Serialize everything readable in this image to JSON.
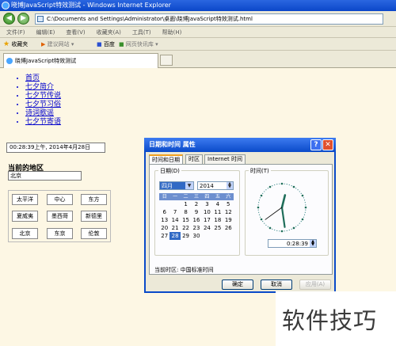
{
  "window": {
    "title": "晓博JavaScript特效测试 - Windows Internet Explorer",
    "address": "C:\\Documents and Settings\\Administrator\\桌面\\晓博JavaScript特效测试.html"
  },
  "menubar": [
    "文件(F)",
    "编辑(E)",
    "查看(V)",
    "收藏夹(A)",
    "工具(T)",
    "帮助(H)"
  ],
  "favbar": {
    "favorites": "收藏夹",
    "suggested": "建议网站 ▾",
    "baidu": "百度",
    "webslice": "网页快讯库 ▾"
  },
  "tab": {
    "title": "晓博JavaScript特效测试"
  },
  "page": {
    "nav_items": [
      "首页",
      "七夕简介",
      "七夕节传说",
      "七夕节习俗",
      "诗词歌谣",
      "七夕节寄语"
    ],
    "clock_text": "00:28:39上午, 2014年4月28日",
    "region_heading": "当前的地区",
    "region_value": "北京",
    "cities": [
      "太平洋",
      "中心",
      "东方",
      "夏威夷",
      "墨西哥",
      "新德里",
      "北京",
      "东京",
      "伦敦"
    ]
  },
  "dialog": {
    "title": "日期和时间 属性",
    "tabs": [
      "时间和日期",
      "时区",
      "Internet 时间"
    ],
    "date_group": "日期(D)",
    "time_group": "时间(T)",
    "month": "四月",
    "year": "2014",
    "weekdays": [
      "日",
      "一",
      "二",
      "三",
      "四",
      "五",
      "六"
    ],
    "days": [
      "",
      "",
      "1",
      "2",
      "3",
      "4",
      "5",
      "6",
      "7",
      "8",
      "9",
      "10",
      "11",
      "12",
      "13",
      "14",
      "15",
      "16",
      "17",
      "18",
      "19",
      "20",
      "21",
      "22",
      "23",
      "24",
      "25",
      "26",
      "27",
      "28",
      "29",
      "30"
    ],
    "selected_day": "28",
    "time_value": "0:28:39",
    "timezone": "当前时区: 中国标准时间",
    "ok": "确定",
    "cancel": "取消",
    "apply": "应用(A)"
  },
  "watermark": "软件技巧",
  "colors": {
    "title_blue": "#0a4ac9",
    "page_bg": "#fdf7e4",
    "selection": "#316ac5",
    "clock_hand": "#1f6e5a"
  }
}
